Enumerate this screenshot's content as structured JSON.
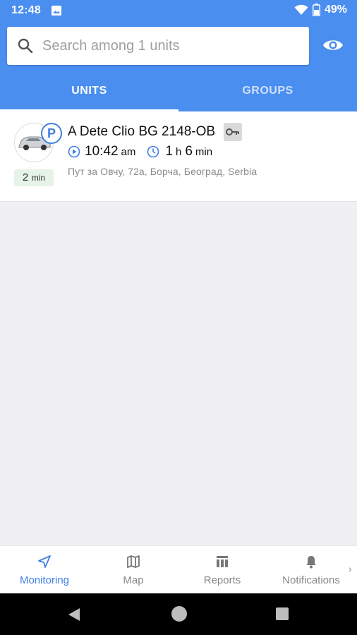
{
  "status_bar": {
    "time": "12:48",
    "battery": "49%",
    "icons": [
      "image-icon",
      "wifi-icon",
      "battery-icon"
    ]
  },
  "search": {
    "placeholder": "Search among 1 units",
    "value": ""
  },
  "visibility_icon": "eye-icon",
  "tabs": [
    {
      "label": "UNITS",
      "active": true
    },
    {
      "label": "GROUPS",
      "active": false
    }
  ],
  "units": [
    {
      "name": "A Dete Clio BG 2148-OB",
      "state_badge": "P",
      "last_message_age": {
        "value": "2",
        "unit": "min"
      },
      "time": {
        "value": "10:42",
        "suffix": "am"
      },
      "duration": {
        "hours": "1",
        "hours_unit": "h",
        "minutes": "6",
        "minutes_unit": "min"
      },
      "address": "Пут за Овчу, 72а, Борча, Београд, Serbia",
      "icons": [
        "car-icon",
        "key-icon",
        "play-icon",
        "clock-icon"
      ]
    }
  ],
  "bottom_nav": [
    {
      "label": "Monitoring",
      "icon": "navigation-arrow-icon",
      "active": true
    },
    {
      "label": "Map",
      "icon": "map-icon",
      "active": false
    },
    {
      "label": "Reports",
      "icon": "reports-icon",
      "active": false
    },
    {
      "label": "Notifications",
      "icon": "bell-icon",
      "active": false
    }
  ],
  "colors": {
    "primary": "#4a8ef0",
    "accent": "#3f7fe6",
    "age_badge_bg": "#e6f3e8",
    "background": "#efeff4"
  }
}
